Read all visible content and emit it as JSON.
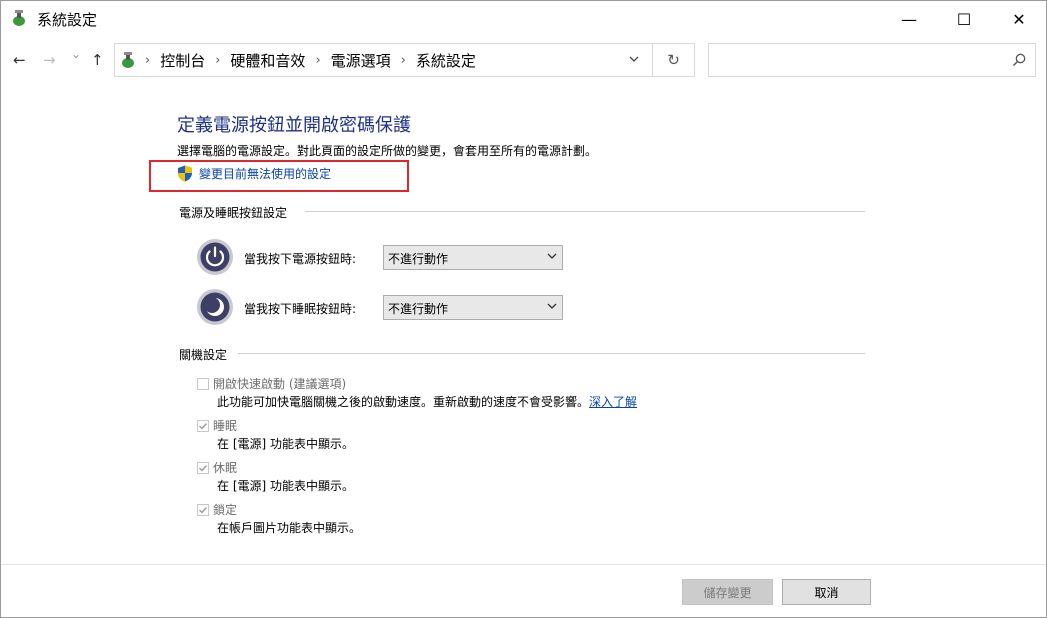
{
  "window": {
    "title": "系統設定"
  },
  "titlebar": {
    "minimize_glyph": "—",
    "maximize_glyph": "☐",
    "close_glyph": "✕"
  },
  "nav": {
    "back_glyph": "←",
    "forward_glyph": "→",
    "recent_glyph": "⌄",
    "up_glyph": "↑",
    "breadcrumbs": [
      "控制台",
      "硬體和音效",
      "電源選項",
      "系統設定"
    ],
    "refresh_glyph": "↻",
    "search": {
      "value": "",
      "placeholder": ""
    }
  },
  "main": {
    "heading": "定義電源按鈕並開啟密碼保護",
    "description": "選擇電腦的電源設定。對此頁面的設定所做的變更，會套用至所有的電源計劃。",
    "change_link": "變更目前無法使用的設定",
    "power_section": {
      "title": "電源及睡眠按鈕設定",
      "rows": [
        {
          "label": "當我按下電源按鈕時:",
          "value": "不進行動作",
          "icon": "power-button-icon"
        },
        {
          "label": "當我按下睡眠按鈕時:",
          "value": "不進行動作",
          "icon": "sleep-button-icon"
        }
      ]
    },
    "shutdown_section": {
      "title": "關機設定",
      "items": [
        {
          "label": "開啟快速啟動 (建議選項)",
          "checked": false,
          "desc": "此功能可加快電腦關機之後的啟動速度。重新啟動的速度不會受影響。",
          "link": "深入了解"
        },
        {
          "label": "睡眠",
          "checked": true,
          "desc": "在 [電源] 功能表中顯示。"
        },
        {
          "label": "休眠",
          "checked": true,
          "desc": "在 [電源] 功能表中顯示。"
        },
        {
          "label": "鎖定",
          "checked": true,
          "desc": "在帳戶圖片功能表中顯示。"
        }
      ]
    }
  },
  "footer": {
    "save_label": "儲存變更",
    "cancel_label": "取消"
  },
  "colors": {
    "heading": "#1e3287",
    "link": "#0645ad",
    "highlight": "#e4262c",
    "disabled_text": "#6d6d6d"
  }
}
